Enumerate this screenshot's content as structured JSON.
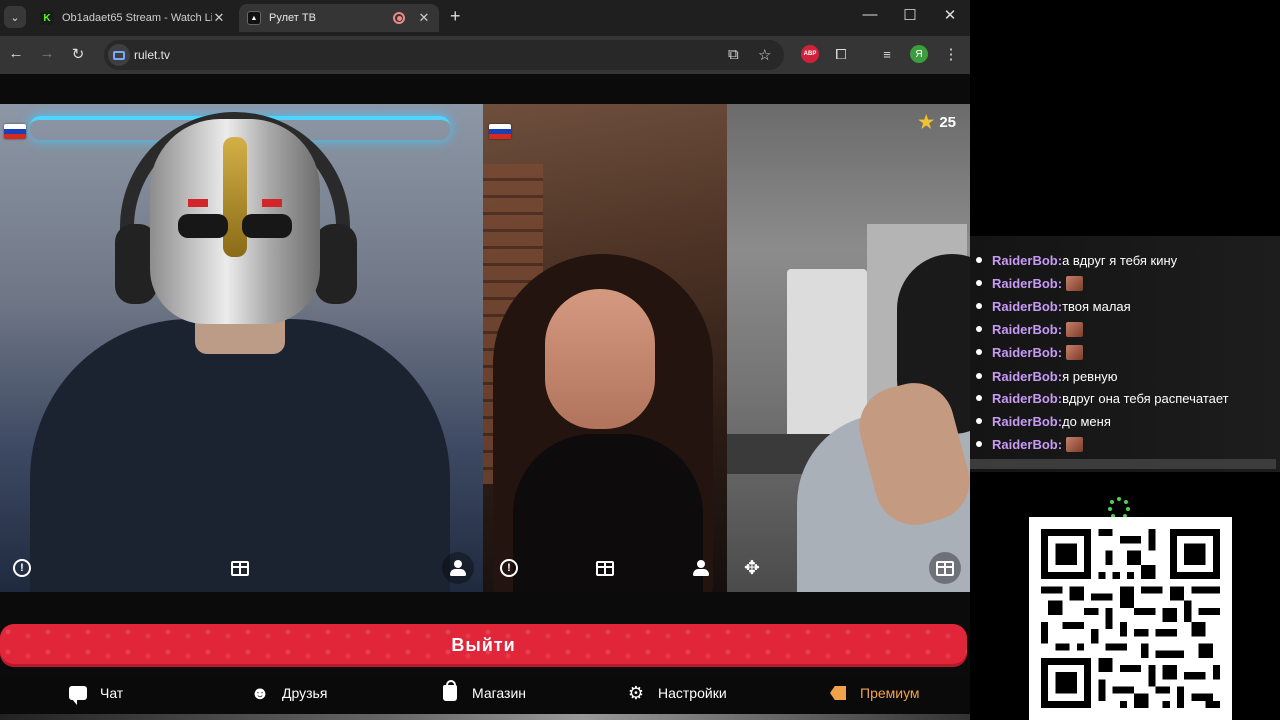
{
  "browser": {
    "tabs": [
      {
        "title": "Ob1adaet65 Stream - Watch Li",
        "favicon": "kick-icon",
        "active": false
      },
      {
        "title": "Рулет ТВ",
        "favicon": "rulet-icon",
        "active": true
      }
    ],
    "url": "rulet.tv",
    "profile_initial": "Я",
    "abp_label": "ABP"
  },
  "videos": [
    {
      "flag": "russia-flag",
      "controls": [
        "report-icon",
        "gift-icon",
        "profile-icon"
      ]
    },
    {
      "flag": "russia-flag",
      "controls": [
        "report-icon",
        "gift-icon",
        "profile-icon"
      ]
    },
    {
      "stars": "25",
      "controls": [
        "game-icon",
        "gift-icon"
      ]
    }
  ],
  "exit_button": {
    "label": "Выйти"
  },
  "bottom_nav": {
    "items": [
      {
        "label": "Чат",
        "icon": "chat-icon"
      },
      {
        "label": "Друзья",
        "icon": "friends-icon"
      },
      {
        "label": "Магазин",
        "icon": "shop-icon"
      },
      {
        "label": "Настройки",
        "icon": "gear-icon"
      },
      {
        "label": "Премиум",
        "icon": "tag-icon"
      }
    ]
  },
  "chat": {
    "messages": [
      {
        "user": "RaiderBob:",
        "text": "а вдруг я тебя кину"
      },
      {
        "user": "RaiderBob:",
        "text": "",
        "emote": true
      },
      {
        "user": "RaiderBob:",
        "text": "твоя малая"
      },
      {
        "user": "RaiderBob:",
        "text": "",
        "emote": true
      },
      {
        "user": "RaiderBob:",
        "text": "",
        "emote": true
      },
      {
        "user": "RaiderBob:",
        "text": "я ревную"
      },
      {
        "user": "RaiderBob:",
        "text": "вдруг она тебя распечатает"
      },
      {
        "user": "RaiderBob:",
        "text": "до меня"
      },
      {
        "user": "RaiderBob:",
        "text": "",
        "emote": true
      }
    ]
  },
  "colors": {
    "accent_red": "#e1263a",
    "premium": "#f0a24a",
    "chat_nick": "#c79af5"
  }
}
